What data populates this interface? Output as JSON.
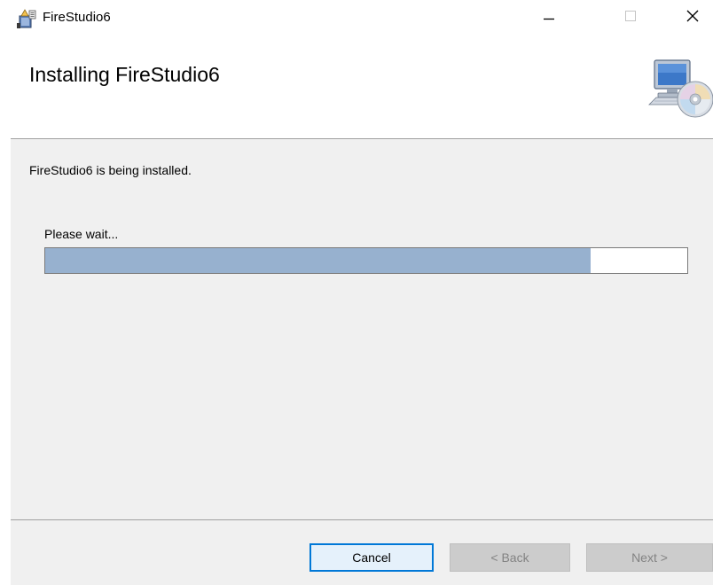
{
  "window": {
    "title": "FireStudio6",
    "app_icon": "setup-installer-icon",
    "controls": {
      "minimize_icon": "minimize-icon",
      "maximize_icon": "maximize-icon",
      "close_icon": "close-icon"
    }
  },
  "header": {
    "title": "Installing FireStudio6",
    "graphic_icon": "computer-cd-icon"
  },
  "content": {
    "status": "FireStudio6 is being installed.",
    "wait_label": "Please wait...",
    "progress_percent": 85
  },
  "footer": {
    "cancel_label": "Cancel",
    "back_label": "< Back",
    "next_label": "Next >"
  },
  "colors": {
    "progress_fill": "#97b1cf",
    "focus_border": "#0078d7",
    "panel_background": "#f0f0f0",
    "disabled_text": "#838383"
  }
}
